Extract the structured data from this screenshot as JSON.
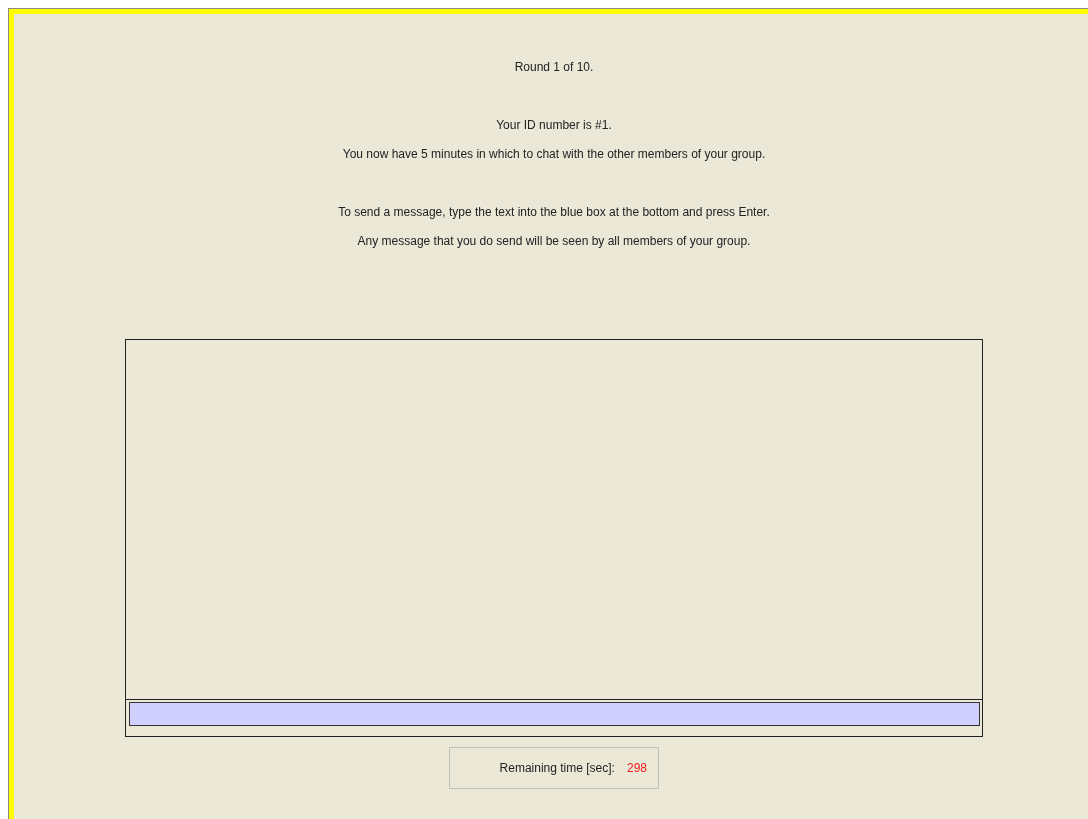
{
  "paragraphs": [
    [
      "Round 1 of 10."
    ],
    [
      "Your ID number is #1.",
      "You now have 5 minutes in which to chat with the other members of your group."
    ],
    [
      "To send a message, type the text into the blue box at the bottom and press Enter.",
      "Any message that you do send will be seen by all members of your group."
    ]
  ],
  "timer": {
    "label": "Remaining time [sec]:",
    "value": "298"
  }
}
